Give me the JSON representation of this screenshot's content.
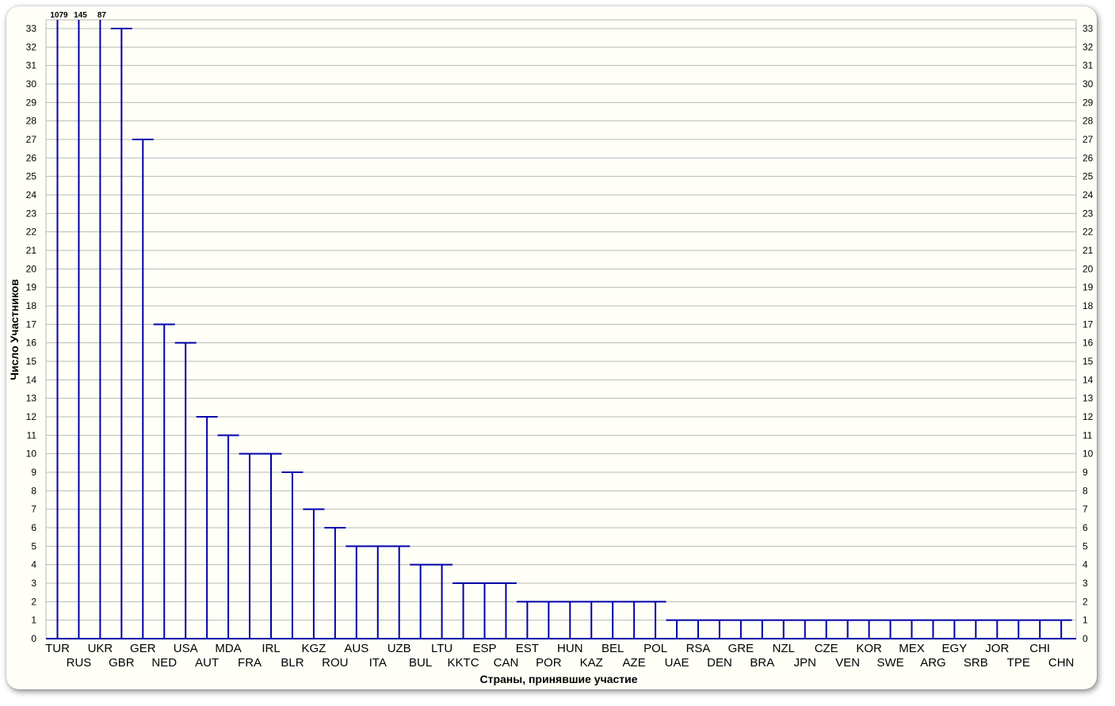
{
  "chart_data": {
    "type": "bar",
    "xlabel": "Страны, принявшие участие",
    "ylabel": "Число Участников",
    "ylim": [
      0,
      33
    ],
    "grid": true,
    "legend": "none",
    "bar_color": "#0000aa",
    "grid_color": "#b8b8b8",
    "categories": [
      "TUR",
      "RUS",
      "UKR",
      "GBR",
      "GER",
      "NED",
      "USA",
      "AUT",
      "MDA",
      "FRA",
      "IRL",
      "BLR",
      "KGZ",
      "ROU",
      "AUS",
      "ITA",
      "UZB",
      "BUL",
      "LTU",
      "KKTC",
      "ESP",
      "CAN",
      "EST",
      "POR",
      "HUN",
      "KAZ",
      "BEL",
      "AZE",
      "POL",
      "UAE",
      "RSA",
      "DEN",
      "GRE",
      "BRA",
      "NZL",
      "JPN",
      "CZE",
      "VEN",
      "KOR",
      "SWE",
      "MEX",
      "ARG",
      "EGY",
      "SRB",
      "JOR",
      "TPE",
      "CHI",
      "CHN"
    ],
    "values": [
      1079,
      145,
      87,
      33,
      27,
      17,
      16,
      12,
      11,
      10,
      10,
      9,
      7,
      6,
      5,
      5,
      5,
      4,
      4,
      3,
      3,
      3,
      2,
      2,
      2,
      2,
      2,
      2,
      2,
      1,
      1,
      1,
      1,
      1,
      1,
      1,
      1,
      1,
      1,
      1,
      1,
      1,
      1,
      1,
      1,
      1,
      1,
      1
    ],
    "overflow_labels": [
      "1079",
      "145",
      "87"
    ]
  }
}
